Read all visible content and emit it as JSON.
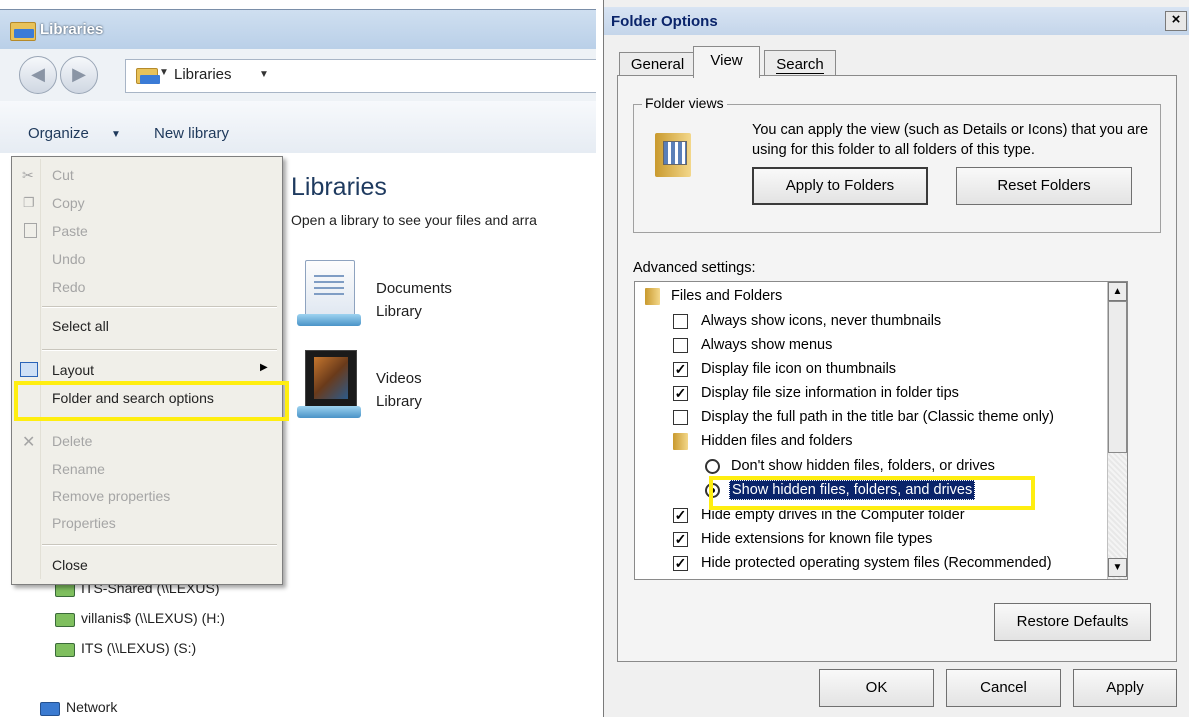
{
  "explorer": {
    "title": "Libraries",
    "address": "Libraries",
    "toolbar": {
      "organize": "Organize",
      "new_library": "New library"
    },
    "main": {
      "heading": "Libraries",
      "subtitle": "Open a library to see your files and arra",
      "items": [
        {
          "name": "Documents",
          "type": "Library"
        },
        {
          "name": "Videos",
          "type": "Library"
        }
      ]
    },
    "nav_pane": {
      "drives": [
        "ITS-Shared (\\\\LEXUS)",
        "villanis$ (\\\\LEXUS) (H:)",
        "ITS (\\\\LEXUS) (S:)"
      ],
      "network": "Network"
    },
    "context_menu": {
      "items": [
        {
          "label": "Cut",
          "enabled": false
        },
        {
          "label": "Copy",
          "enabled": false
        },
        {
          "label": "Paste",
          "enabled": false
        },
        {
          "label": "Undo",
          "enabled": false
        },
        {
          "label": "Redo",
          "enabled": false
        },
        {
          "label": "Select all",
          "enabled": true
        },
        {
          "label": "Layout",
          "enabled": true
        },
        {
          "label": "Folder and search options",
          "enabled": true,
          "highlighted": true
        },
        {
          "label": "Delete",
          "enabled": false
        },
        {
          "label": "Rename",
          "enabled": false
        },
        {
          "label": "Remove properties",
          "enabled": false
        },
        {
          "label": "Properties",
          "enabled": false
        },
        {
          "label": "Close",
          "enabled": true
        }
      ]
    }
  },
  "dialog": {
    "title": "Folder Options",
    "close_glyph": "×",
    "tabs": [
      "General",
      "View",
      "Search"
    ],
    "active_tab": "View",
    "folder_views": {
      "legend": "Folder views",
      "text": "You can apply the view (such as Details or Icons) that you are using for this folder to all folders of this type.",
      "apply_button": "Apply to Folders",
      "reset_button": "Reset Folders"
    },
    "advanced_label": "Advanced settings:",
    "advanced_items": [
      {
        "kind": "folder",
        "label": "Files and Folders"
      },
      {
        "kind": "checkbox",
        "label": "Always show icons, never thumbnails",
        "checked": false
      },
      {
        "kind": "checkbox",
        "label": "Always show menus",
        "checked": false
      },
      {
        "kind": "checkbox",
        "label": "Display file icon on thumbnails",
        "checked": true
      },
      {
        "kind": "checkbox",
        "label": "Display file size information in folder tips",
        "checked": true
      },
      {
        "kind": "checkbox",
        "label": "Display the full path in the title bar (Classic theme only)",
        "checked": false
      },
      {
        "kind": "folder",
        "label": "Hidden files and folders"
      },
      {
        "kind": "radio",
        "label": "Don't show hidden files, folders, or drives",
        "checked": false
      },
      {
        "kind": "radio",
        "label": "Show hidden files, folders, and drives",
        "checked": true
      },
      {
        "kind": "checkbox",
        "label": "Hide empty drives in the Computer folder",
        "checked": true
      },
      {
        "kind": "checkbox",
        "label": "Hide extensions for known file types",
        "checked": true
      },
      {
        "kind": "checkbox",
        "label": "Hide protected operating system files (Recommended)",
        "checked": true
      }
    ],
    "restore_button": "Restore Defaults",
    "ok_button": "OK",
    "cancel_button": "Cancel",
    "apply_button": "Apply",
    "colors": {
      "highlight_box": "#ffee10",
      "selection": "#0a246a"
    }
  }
}
